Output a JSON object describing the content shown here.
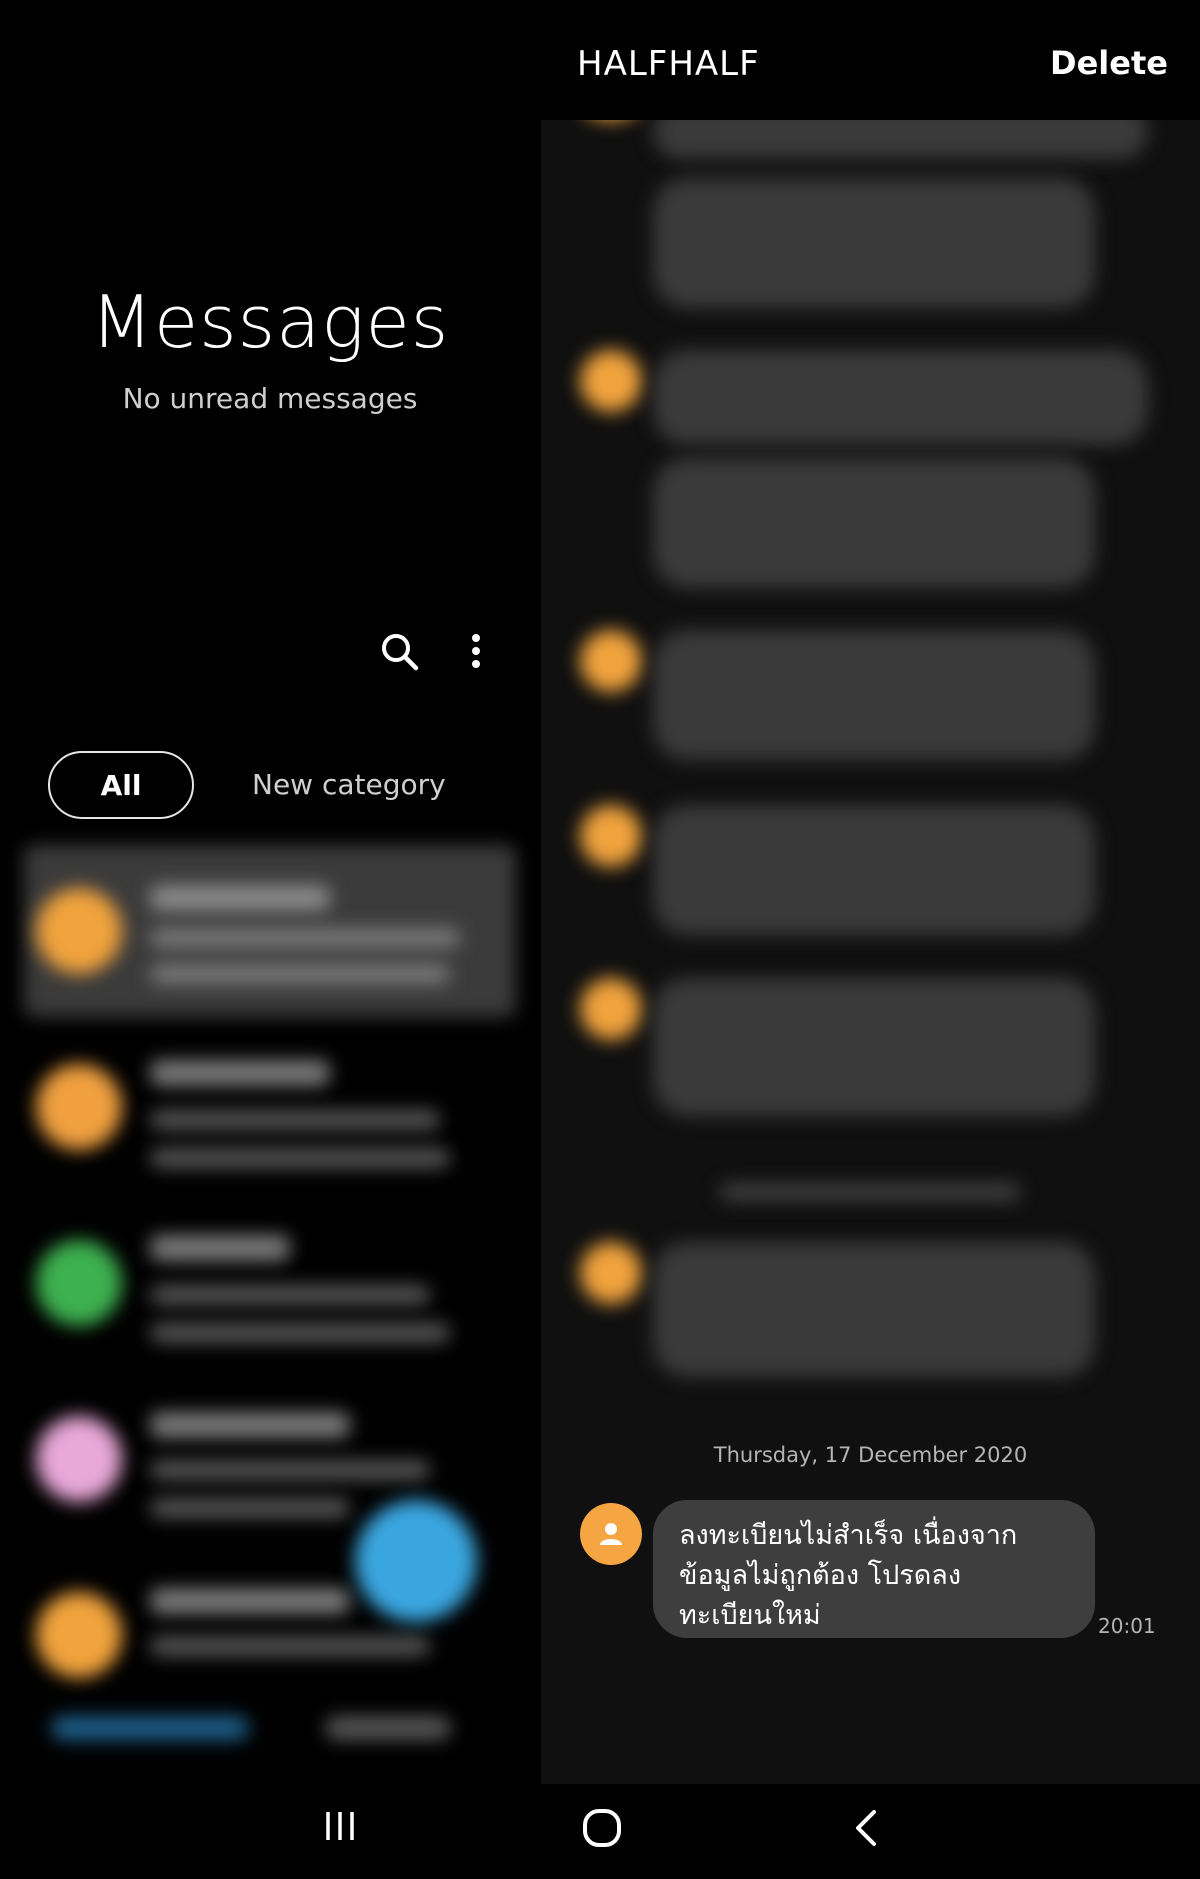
{
  "left": {
    "title": "Messages",
    "subtitle": "No unread messages",
    "tabs": [
      {
        "label": "All",
        "selected": true
      },
      {
        "label": "New category",
        "selected": false
      }
    ],
    "conversation_avatar_colors": [
      "#f1a33d",
      "#f0a040",
      "#3db04f",
      "#e8a8d8",
      "#f1a33d"
    ],
    "fab_color": "#3aa6e0"
  },
  "conversation": {
    "title": "HALFHALF",
    "delete_label": "Delete",
    "date_separator": "Thursday, 17 December 2020",
    "last_message": {
      "line1": "ลงทะเบียนไม่สำเร็จ เนื่องจาก",
      "line2": "ข้อมูลไม่ถูกต้อง โปรดลง",
      "line3": "ทะเบียนใหม่",
      "time": "20:01"
    },
    "avatar_color": "#f5a542"
  },
  "icons": {
    "search": "search-icon",
    "more": "more-vertical-icon",
    "recents": "recents-icon",
    "home": "home-icon",
    "back": "back-icon"
  }
}
